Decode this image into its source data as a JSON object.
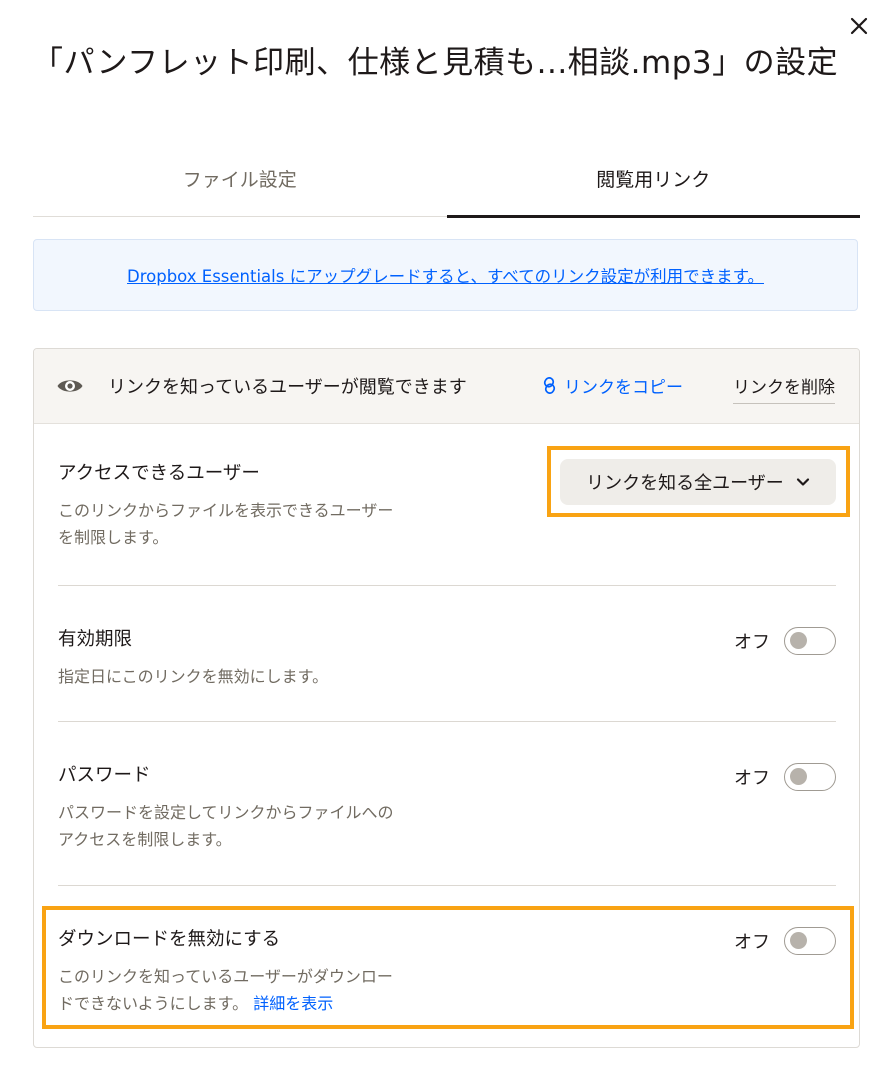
{
  "dialog": {
    "title": "「パンフレット印刷、仕様と見積も...相談.mp3」の設定"
  },
  "tabs": [
    {
      "label": "ファイル設定",
      "active": false
    },
    {
      "label": "閲覧用リンク",
      "active": true
    }
  ],
  "upgrade_banner": {
    "text": "Dropbox Essentials にアップグレードすると、すべてのリンク設定が利用できます。"
  },
  "link_header": {
    "icon": "eye-icon",
    "text": "リンクを知っているユーザーが閲覧できます",
    "copy_icon": "link-icon",
    "copy_label": "リンクをコピー",
    "delete_label": "リンクを削除"
  },
  "settings": {
    "access": {
      "title": "アクセスできるユーザー",
      "description": "このリンクからファイルを表示できるユーザーを制限します。",
      "dropdown_value": "リンクを知る全ユーザー"
    },
    "expiration": {
      "title": "有効期限",
      "description": "指定日にこのリンクを無効にします。",
      "toggle_label": "オフ",
      "enabled": false
    },
    "password": {
      "title": "パスワード",
      "description": "パスワードを設定してリンクからファイルへのアクセスを制限します。",
      "toggle_label": "オフ",
      "enabled": false
    },
    "disable_download": {
      "title": "ダウンロードを無効にする",
      "description": "このリンクを知っているユーザーがダウンロードできないようにします。",
      "detail_link": "詳細を表示",
      "toggle_label": "オフ",
      "enabled": false
    }
  },
  "colors": {
    "accent_blue": "#0061fe",
    "highlight_orange": "#f9a313",
    "banner_background": "#f2f7fe"
  }
}
